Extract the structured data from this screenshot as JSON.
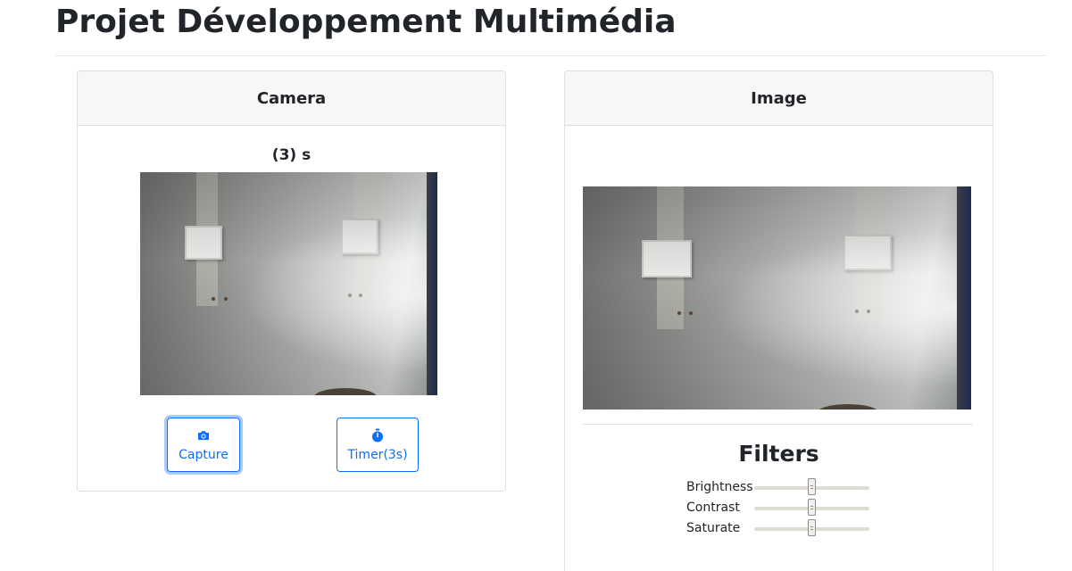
{
  "page": {
    "title": "Projet Développement Multimédia"
  },
  "camera_panel": {
    "header": "Camera",
    "timer_text": "(3) s",
    "capture_label": "Capture",
    "timer_button_label": "Timer(3s)",
    "capture_icon": "camera-icon",
    "timer_icon": "stopwatch-icon"
  },
  "image_panel": {
    "header": "Image",
    "filters_title": "Filters",
    "filters": [
      {
        "label": "Brightness",
        "value": 0.5
      },
      {
        "label": "Contrast",
        "value": 0.5
      },
      {
        "label": "Saturate",
        "value": 0.5
      }
    ]
  },
  "colors": {
    "accent": "#0d6efd",
    "card_header_bg": "#f7f7f7",
    "border": "#dfdfdf"
  }
}
